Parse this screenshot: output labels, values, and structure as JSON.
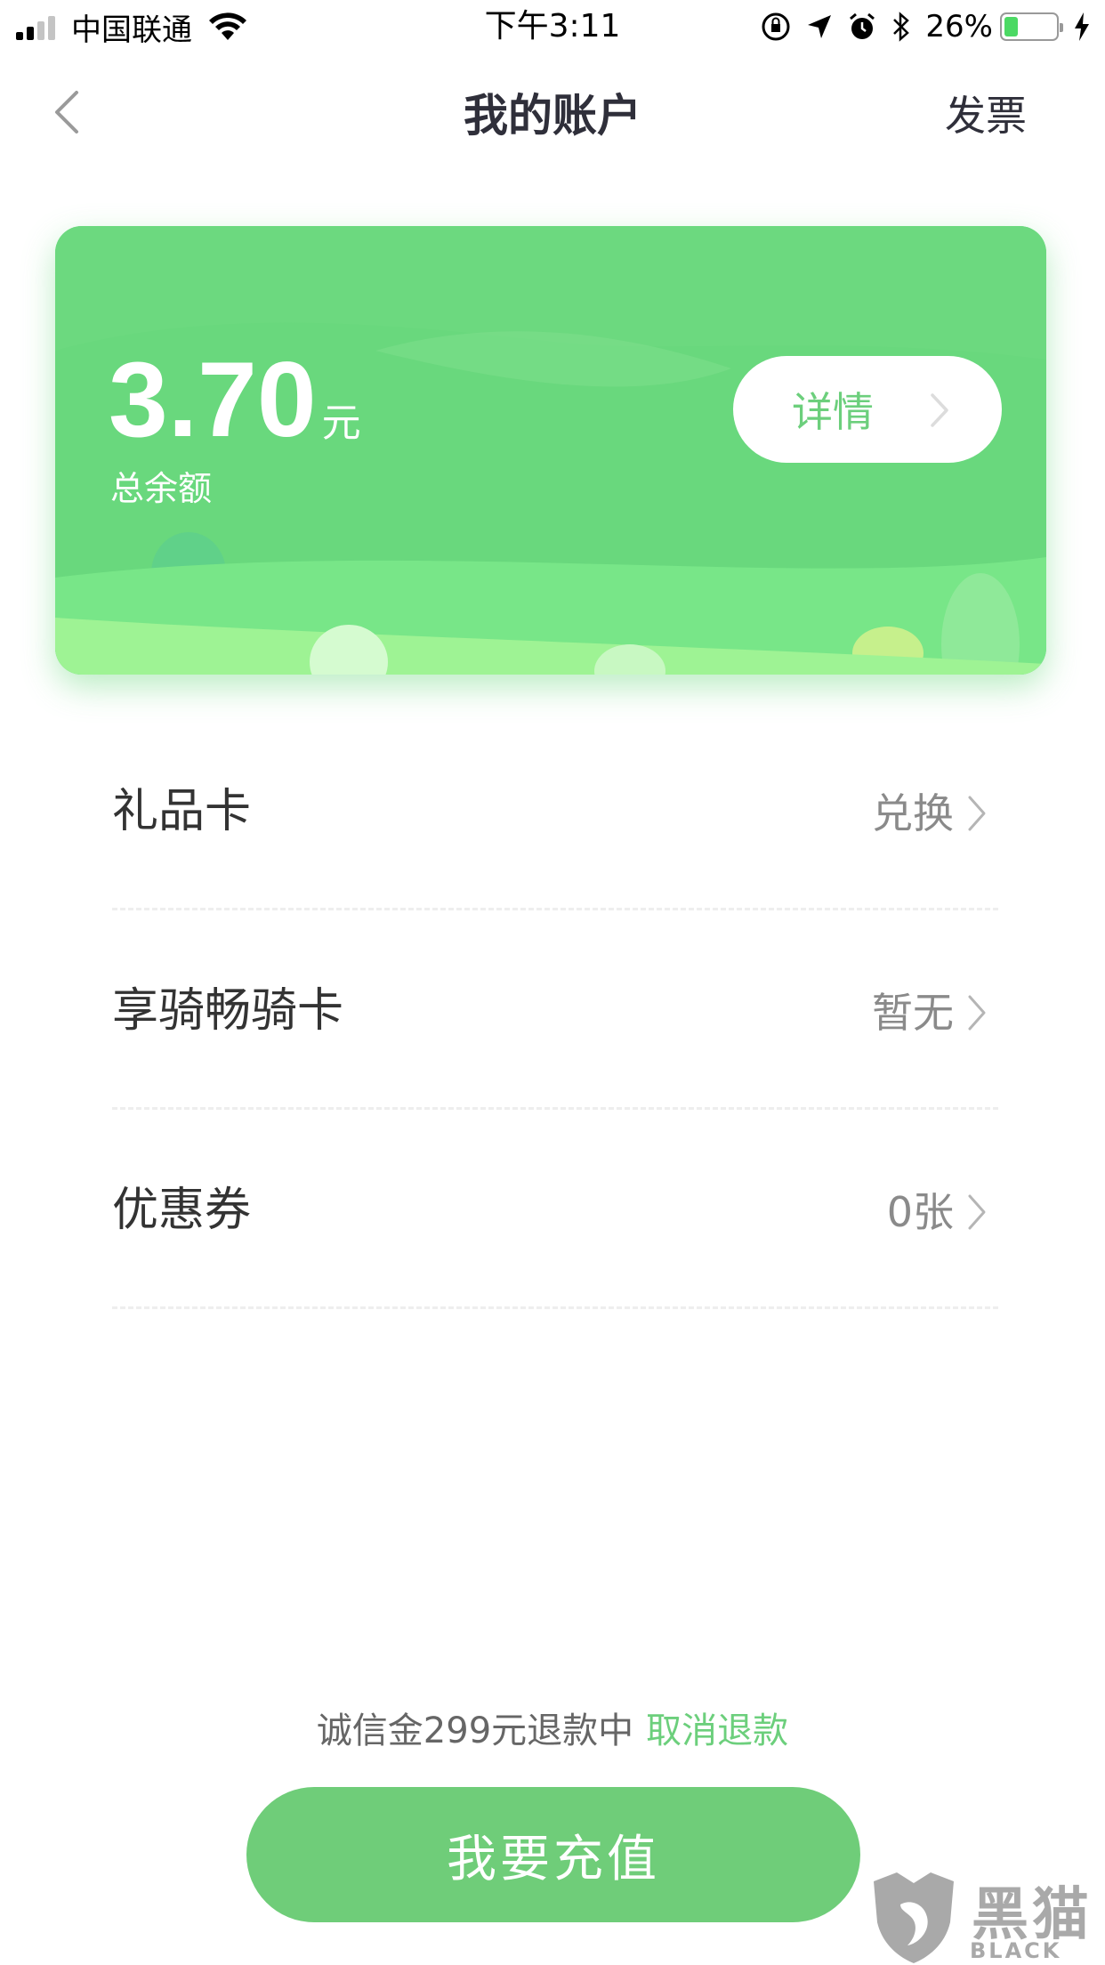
{
  "status_bar": {
    "carrier": "中国联通",
    "time": "下午3:11",
    "battery": "26%",
    "battery_level": 0.26,
    "icons": [
      "signal-icon",
      "wifi-icon",
      "orientation-lock-icon",
      "location-icon",
      "alarm-icon",
      "bluetooth-icon",
      "battery-icon",
      "charging-icon"
    ]
  },
  "nav": {
    "title": "我的账户",
    "right_label": "发票",
    "back_icon": "chevron-left-icon"
  },
  "balance_card": {
    "amount": "3.70",
    "unit": "元",
    "label": "总余额",
    "details_label": "详情",
    "accent": "#69d87d"
  },
  "list": {
    "items": [
      {
        "label": "礼品卡",
        "value": "兑换"
      },
      {
        "label": "享骑畅骑卡",
        "value": "暂无"
      },
      {
        "label": "优惠券",
        "value": "0张"
      }
    ]
  },
  "footer": {
    "deposit_text": "诚信金299元退款中",
    "cancel_refund": "取消退款",
    "recharge_label": "我要充值",
    "button_color": "#6fcd79"
  },
  "watermark": {
    "text": "黑猫",
    "sub": "BLACK CAT"
  }
}
